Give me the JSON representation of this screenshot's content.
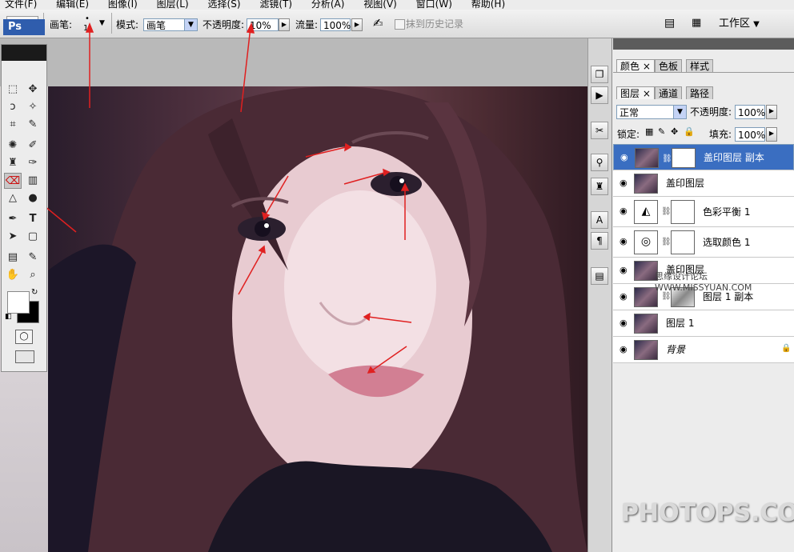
{
  "menubar": {
    "items": [
      "文件(F)",
      "编辑(E)",
      "图像(I)",
      "图层(L)",
      "选择(S)",
      "滤镜(T)",
      "分析(A)",
      "视图(V)",
      "窗口(W)",
      "帮助(H)"
    ]
  },
  "options": {
    "brush_label": "画笔:",
    "brush_size": "1",
    "mode_label": "模式:",
    "mode_value": "画笔",
    "opacity_label": "不透明度:",
    "opacity_value": "10%",
    "flow_label": "流量:",
    "flow_value": "100%",
    "erase_history_label": "抹到历史记录",
    "workspace_label": "工作区"
  },
  "toolbox": {
    "logo": "Ps"
  },
  "panels": {
    "top_tabs": [
      "颜色",
      "色板",
      "样式"
    ],
    "layer_tabs": [
      "图层",
      "通道",
      "路径"
    ],
    "blend_mode": "正常",
    "opacity_label": "不透明度:",
    "opacity_value": "100%",
    "lock_label": "锁定:",
    "fill_label": "填充:",
    "fill_value": "100%"
  },
  "layers": [
    {
      "name": "盖印图层 副本",
      "selected": true
    },
    {
      "name": "盖印图层",
      "selected": false
    },
    {
      "name": "色彩平衡 1",
      "selected": false
    },
    {
      "name": "选取颜色 1",
      "selected": false
    },
    {
      "name": "盖印图层",
      "selected": false
    },
    {
      "name": "图层 1 副本",
      "selected": false
    },
    {
      "name": "图层 1",
      "selected": false
    },
    {
      "name": "背景",
      "selected": false
    }
  ],
  "site_mark": "思缘设计论坛 WWW.MISSYUAN.COM",
  "watermark": "PHOTOPS.COM",
  "colors": {
    "selection": "#3a6ec1",
    "annotation_arrow": "#e02020",
    "logo_bg": "#2f5dad"
  }
}
